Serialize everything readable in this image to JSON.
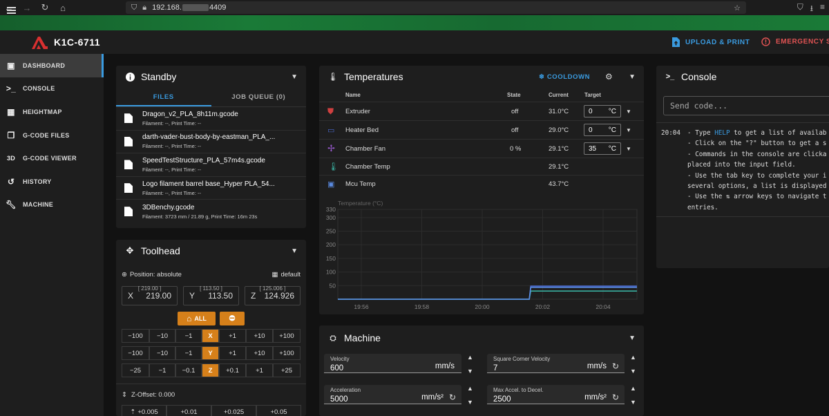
{
  "browser": {
    "url_prefix": "192.168.",
    "url_suffix": "4409"
  },
  "app": {
    "printer_name": "K1C-6711",
    "upload_label": "UPLOAD & PRINT",
    "emergency_label": "EMERGENCY ST"
  },
  "nav": [
    {
      "label": "DASHBOARD",
      "icon": "monitor-dashboard-icon",
      "active": true
    },
    {
      "label": "CONSOLE",
      "icon": "console-icon"
    },
    {
      "label": "HEIGHTMAP",
      "icon": "grid-icon"
    },
    {
      "label": "G-CODE FILES",
      "icon": "file-document-icon"
    },
    {
      "label": "G-CODE VIEWER",
      "icon": "3d-icon"
    },
    {
      "label": "HISTORY",
      "icon": "history-icon"
    },
    {
      "label": "MACHINE",
      "icon": "wrench-icon"
    }
  ],
  "standby": {
    "title": "Standby",
    "tab_files": "FILES",
    "tab_queue": "JOB QUEUE (0)",
    "files": [
      {
        "name": "Dragon_v2_PLA_8h11m.gcode",
        "meta": "Filament: --, Print Time: --"
      },
      {
        "name": "darth-vader-bust-body-by-eastman_PLA_...",
        "meta": "Filament: --, Print Time: --"
      },
      {
        "name": "SpeedTestStructure_PLA_57m4s.gcode",
        "meta": "Filament: --, Print Time: --"
      },
      {
        "name": "Logo filament barrel base_Hyper PLA_54...",
        "meta": "Filament: --, Print Time: --"
      },
      {
        "name": "3DBenchy.gcode",
        "meta": "Filament: 3723 mm / 21.89 g, Print Time: 16m 23s"
      }
    ]
  },
  "toolhead": {
    "title": "Toolhead",
    "position_label": "Position: absolute",
    "grid_label": "default",
    "x": {
      "axis": "X",
      "value": "219.00",
      "limit": "[ 219.00 ]"
    },
    "y": {
      "axis": "Y",
      "value": "113.50",
      "limit": "[ 113.50 ]"
    },
    "z": {
      "axis": "Z",
      "value": "124.926",
      "limit": "[ 125.006 ]"
    },
    "home_all": "ALL",
    "row_x": [
      "−100",
      "−10",
      "−1",
      "X",
      "+1",
      "+10",
      "+100"
    ],
    "row_y": [
      "−100",
      "−10",
      "−1",
      "Y",
      "+1",
      "+10",
      "+100"
    ],
    "row_z": [
      "−25",
      "−1",
      "−0.1",
      "Z",
      "+0.1",
      "+1",
      "+25"
    ],
    "z_offset_label": "Z-Offset: 0.000",
    "offset_buttons": [
      "+0.005",
      "+0.01",
      "+0.025",
      "+0.05"
    ]
  },
  "temperatures": {
    "title": "Temperatures",
    "cooldown": "COOLDOWN",
    "headers": {
      "name": "Name",
      "state": "State",
      "current": "Current",
      "target": "Target"
    },
    "rows": [
      {
        "name": "Extruder",
        "state": "off",
        "current": "31.0°C",
        "target": "0",
        "unit": "°C",
        "color": "#d04040"
      },
      {
        "name": "Heater Bed",
        "state": "off",
        "current": "29.0°C",
        "target": "0",
        "unit": "°C",
        "color": "#4a6ad0"
      },
      {
        "name": "Chamber Fan",
        "state": "0 %",
        "current": "29.1°C",
        "target": "35",
        "unit": "°C",
        "color": "#9a5ad0"
      },
      {
        "name": "Chamber Temp",
        "state": "",
        "current": "29.1°C",
        "target": "",
        "unit": "",
        "color": "#3ab0a0"
      },
      {
        "name": "Mcu Temp",
        "state": "",
        "current": "43.7°C",
        "target": "",
        "unit": "",
        "color": "#5a8ae0"
      }
    ]
  },
  "chart_data": {
    "type": "line",
    "ylabel": "Temperature (°C)",
    "y_ticks": [
      50,
      100,
      150,
      200,
      250,
      300,
      330
    ],
    "ylim": [
      0,
      330
    ],
    "x_ticks": [
      "19:56",
      "19:58",
      "20:00",
      "20:02",
      "20:04"
    ],
    "series": [
      {
        "color": "#4a6ad0",
        "x": [
          0,
          0.64,
          0.645,
          1
        ],
        "y": [
          0,
          0,
          48,
          48
        ]
      },
      {
        "color": "#3ab0a0",
        "x": [
          0,
          0.64,
          0.645,
          1
        ],
        "y": [
          0,
          0,
          30,
          30
        ]
      },
      {
        "color": "#5a8ae0",
        "x": [
          0,
          0.64,
          0.645,
          1
        ],
        "y": [
          0,
          0,
          43.7,
          43.7
        ]
      }
    ]
  },
  "machine": {
    "title": "Machine",
    "velocity": {
      "label": "Velocity",
      "value": "600",
      "unit": "mm/s"
    },
    "scv": {
      "label": "Square Corner Velocity",
      "value": "7",
      "unit": "mm/s"
    },
    "accel": {
      "label": "Acceleration",
      "value": "5000",
      "unit": "mm/s²"
    },
    "decel": {
      "label": "Max Accel. to Decel.",
      "value": "2500",
      "unit": "mm/s²"
    }
  },
  "console": {
    "title": "Console",
    "placeholder": "Send code...",
    "time": "20:04",
    "lines": [
      {
        "pre": "- Type ",
        "hl": "HELP",
        "post": " to get a list of availab"
      },
      {
        "pre": "- Click on the \"?\" button to get a s",
        "hl": "",
        "post": ""
      },
      {
        "pre": "- Commands in the console are clicka",
        "hl": "",
        "post": ""
      },
      {
        "pre": "placed into the input field.",
        "hl": "",
        "post": ""
      },
      {
        "pre": "- Use the tab key to complete your i",
        "hl": "",
        "post": ""
      },
      {
        "pre": "several options, a list is displayed",
        "hl": "",
        "post": ""
      },
      {
        "pre": "- Use the ⇅ arrow keys to navigate t",
        "hl": "",
        "post": ""
      },
      {
        "pre": "entries.",
        "hl": "",
        "post": ""
      }
    ]
  }
}
